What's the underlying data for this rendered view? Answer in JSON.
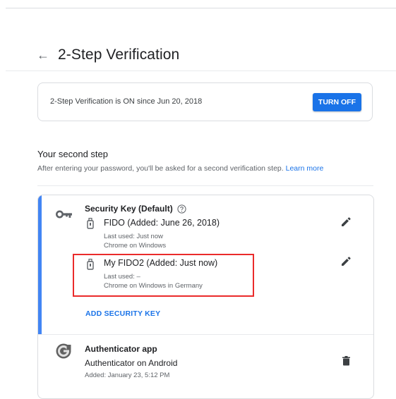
{
  "header": {
    "back_icon": "arrow-left-icon",
    "title": "2-Step Verification"
  },
  "status": {
    "text": "2-Step Verification is ON since Jun 20, 2018",
    "button_label": "TURN OFF"
  },
  "second_step": {
    "title": "Your second step",
    "description": "After entering your password, you'll be asked for a second verification step.",
    "learn_more": "Learn more"
  },
  "security_key": {
    "icon": "key-icon",
    "title": "Security Key (Default)",
    "help_icon": "help-circle-icon",
    "keys": [
      {
        "name": "FIDO (Added: June 26, 2018)",
        "last_used": "Last used: Just now",
        "device": "Chrome on Windows"
      },
      {
        "name": "My FIDO2 (Added: Just now)",
        "last_used": "Last used: –",
        "device": "Chrome on Windows in Germany"
      }
    ],
    "add_label": "ADD SECURITY KEY"
  },
  "authenticator": {
    "icon": "google-authenticator-icon",
    "title": "Authenticator app",
    "subtitle": "Authenticator on Android",
    "added": "Added: January 23, 5:12 PM"
  },
  "colors": {
    "accent": "#1a73e8",
    "accent_bar": "#4285f4",
    "highlight": "#ea2b2b"
  }
}
